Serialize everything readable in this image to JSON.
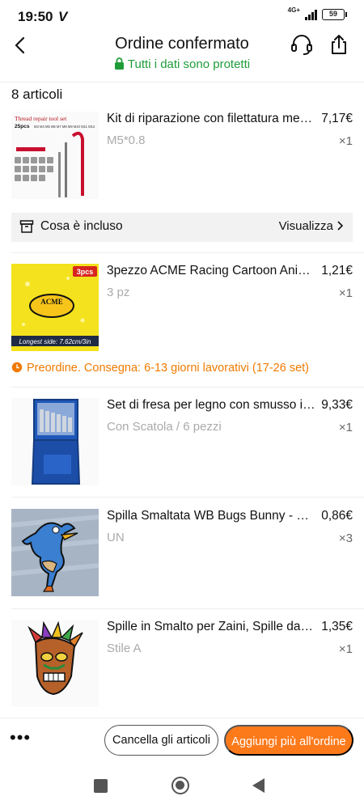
{
  "status_bar": {
    "time": "19:50",
    "carrier_logo": "V",
    "network": "4G+",
    "battery": "59"
  },
  "header": {
    "title": "Ordine confermato",
    "subtitle": "Tutti i dati sono protetti",
    "back_icon": "chevron-left-icon",
    "support_icon": "headset-icon",
    "share_icon": "share-icon"
  },
  "order": {
    "count_label": "8 articoli",
    "items": [
      {
        "title": "Kit di riparazione con filettatura met…",
        "price": "7,17€",
        "variant": "M5*0.8",
        "qty": "×1",
        "thumb_text_1": "Thread repair tool set",
        "thumb_text_2": "25pcs",
        "thumb_text_3": "M3 M4 M5 M6 M7 M8 M9 M10 M11 M12"
      },
      {
        "title": "3pezzo ACME Racing Cartoon Anim…",
        "price": "1,21€",
        "variant": "3 pz",
        "qty": "×1",
        "thumb_badge": "3pcs",
        "thumb_brand": "ACME",
        "thumb_caption": "Longest side: 7.62cm/3in"
      },
      {
        "title": "Set di fresa per legno con smusso i…",
        "price": "9,33€",
        "variant": "Con Scatola / 6 pezzi",
        "qty": "×1"
      },
      {
        "title": "Spilla Smaltata WB Bugs Bunny - Sp…",
        "price": "0,86€",
        "variant": "UN",
        "qty": "×3"
      },
      {
        "title": "Spille in Smalto per Zaini, Spille da B…",
        "price": "1,35€",
        "variant": "Stile A",
        "qty": "×1"
      }
    ],
    "included_label": "Cosa è incluso",
    "included_action": "Visualizza",
    "preorder_text": "Preordine. Consegna: 6-13 giorni lavorativi (17-26 set)"
  },
  "actions": {
    "more": "•••",
    "cancel_label": "Cancella gli articoli",
    "add_label": "Aggiungi più all'ordine"
  },
  "colors": {
    "accent_orange": "#fd7a1b",
    "secure_green": "#1e9c3a",
    "preorder_orange": "#f07a00"
  }
}
